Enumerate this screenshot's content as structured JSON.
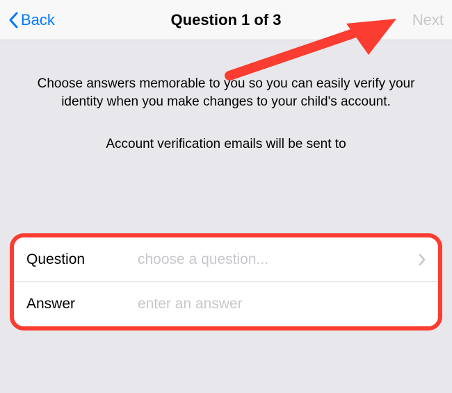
{
  "nav": {
    "back_label": "Back",
    "title": "Question 1 of 3",
    "next_label": "Next"
  },
  "content": {
    "instruction": "Choose answers memorable to you so you can easily verify your identity when you make changes to your child's account.",
    "verification_note": "Account verification emails will be sent to"
  },
  "form": {
    "question_label": "Question",
    "question_placeholder": "choose a question...",
    "answer_label": "Answer",
    "answer_placeholder": "enter an answer"
  },
  "colors": {
    "highlight": "#fb3c30",
    "link": "#007aff",
    "placeholder": "#c7c7cc"
  }
}
